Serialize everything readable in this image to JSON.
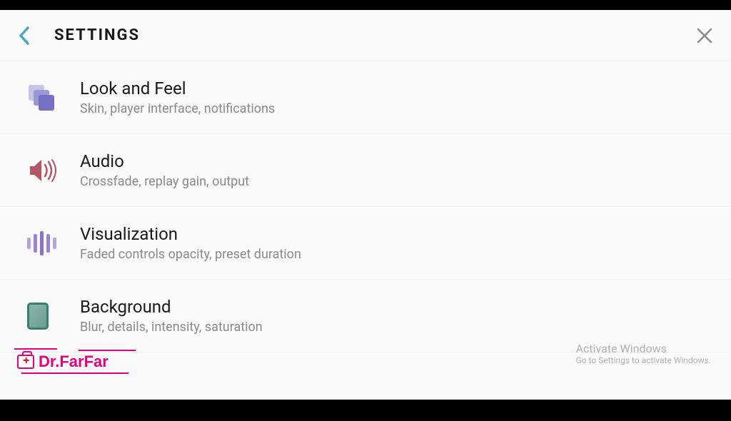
{
  "header": {
    "title": "SETTINGS"
  },
  "items": [
    {
      "title": "Look and Feel",
      "subtitle": "Skin, player interface, notifications",
      "icon": "look-feel-icon"
    },
    {
      "title": "Audio",
      "subtitle": "Crossfade, replay gain, output",
      "icon": "audio-icon"
    },
    {
      "title": "Visualization",
      "subtitle": "Faded controls opacity, preset duration",
      "icon": "visualization-icon"
    },
    {
      "title": "Background",
      "subtitle": "Blur, details, intensity, saturation",
      "icon": "background-icon"
    }
  ],
  "watermark": {
    "line1": "Activate Windows",
    "line2": "Go to Settings to activate Windows."
  },
  "logo": {
    "text": "Dr.FarFar"
  }
}
